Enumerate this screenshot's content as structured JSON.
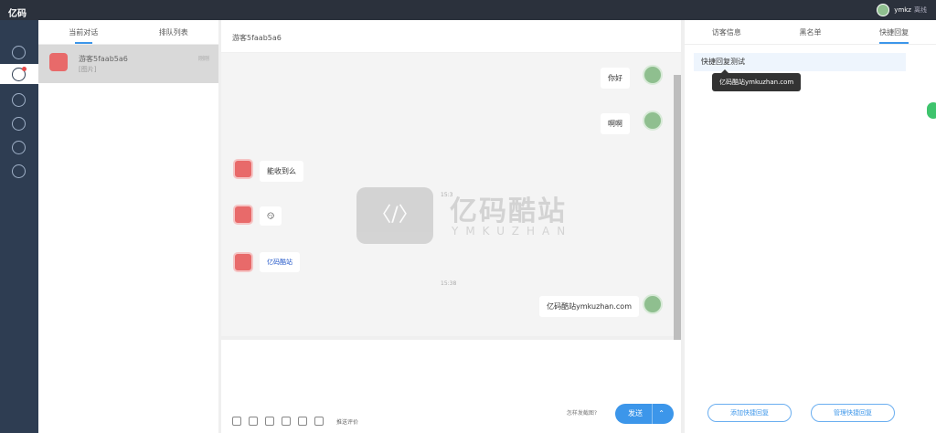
{
  "app": {
    "logo": "亿码",
    "user_name": "ymkz",
    "user_status": "离线"
  },
  "conversations": {
    "tabs": [
      "当前对话",
      "排队列表"
    ],
    "items": [
      {
        "name": "游客5faab5a6",
        "last": "[图片]",
        "time": "刚刚"
      }
    ]
  },
  "chat": {
    "header": "游客5faab5a6",
    "messages": [
      "你好",
      "啊啊",
      "能收到么",
      "😏",
      "亿码酷站ymkuzhan.com"
    ],
    "times": [
      "15:3",
      "15:38"
    ],
    "image_label": "亿码酷站"
  },
  "editor": {
    "eval": "推送评价",
    "screenshot": "怎样发截图?",
    "send": "发送",
    "send_arrow": "⌃"
  },
  "right": {
    "tabs": [
      "访客信息",
      "黑名单",
      "快捷回复"
    ],
    "quick": "快捷回复测试",
    "tooltip": "亿码酷站ymkuzhan.com",
    "add": "添加快捷回复",
    "manage": "管理快捷回复"
  },
  "watermark": {
    "logo": "〈/〉",
    "title": "亿码酷站",
    "subtitle": "YMKUZHAN"
  },
  "colors": {
    "accent": "#3c96ea",
    "nav": "#2e3d52",
    "topbar": "#2b313c"
  }
}
